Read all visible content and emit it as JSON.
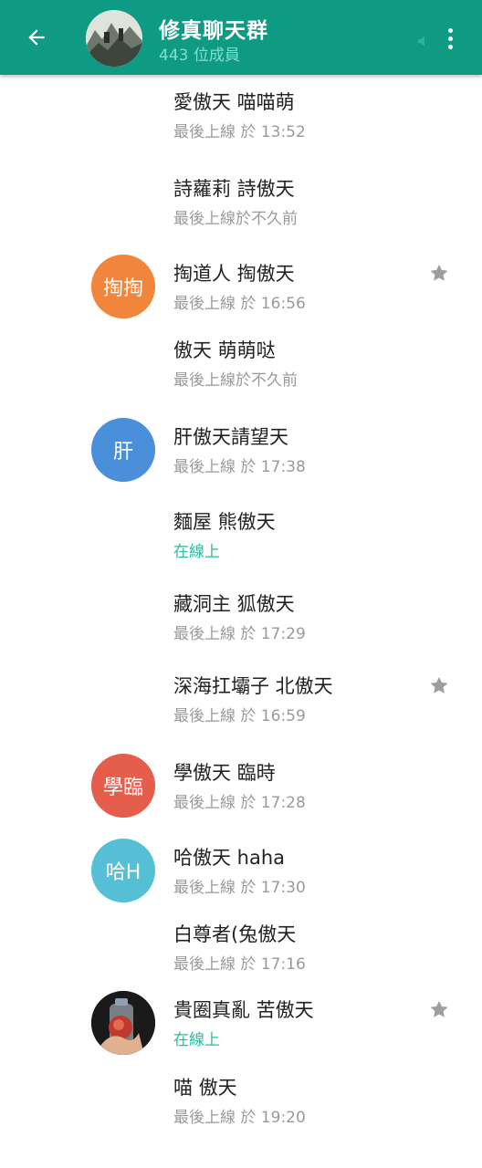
{
  "header": {
    "title": "修真聊天群",
    "subtitle": "443 位成員",
    "back_icon": "arrow-left-icon",
    "more_icon": "more-vertical-icon",
    "color": "#0e9a83"
  },
  "members": [
    {
      "name": "愛傲天 喵喵萌",
      "status": "最後上線 於 13:52",
      "online": false,
      "starred": false,
      "avatar": null
    },
    {
      "name": "詩蘿莉 詩傲天",
      "status": "最後上線於不久前",
      "online": false,
      "starred": false,
      "avatar": null
    },
    {
      "name": "掏道人 掏傲天",
      "status": "最後上線 於 16:56",
      "online": false,
      "starred": true,
      "avatar": {
        "text": "掏掏",
        "color": "#f0853b"
      }
    },
    {
      "name": "傲天 萌萌哒",
      "status": "最後上線於不久前",
      "online": false,
      "starred": false,
      "avatar": null
    },
    {
      "name": "肝傲天請望天",
      "status": "最後上線 於 17:38",
      "online": false,
      "starred": false,
      "avatar": {
        "text": "肝",
        "color": "#4a8fd9"
      }
    },
    {
      "name": "麵屋 熊傲天",
      "status": "在線上",
      "online": true,
      "starred": false,
      "avatar": null
    },
    {
      "name": "藏洞主 狐傲天",
      "status": "最後上線 於 17:29",
      "online": false,
      "starred": false,
      "avatar": null
    },
    {
      "name": "深海扛壩子 北傲天",
      "status": "最後上線 於 16:59",
      "online": false,
      "starred": true,
      "avatar": null
    },
    {
      "name": "學傲天 臨時",
      "status": "最後上線 於 17:28",
      "online": false,
      "starred": false,
      "avatar": {
        "text": "學臨",
        "color": "#e55d4b"
      }
    },
    {
      "name": "哈傲天 haha",
      "status": "最後上線 於 17:30",
      "online": false,
      "starred": false,
      "avatar": {
        "text": "哈H",
        "color": "#55bfd6"
      }
    },
    {
      "name": "白尊者(兔傲天",
      "status": "最後上線 於 17:16",
      "online": false,
      "starred": false,
      "avatar": null
    },
    {
      "name": "貴圈真亂 苦傲天",
      "status": "在線上",
      "online": true,
      "starred": true,
      "avatar": {
        "text": "",
        "color": "#1a1a1a",
        "photo": true
      }
    },
    {
      "name": "喵 傲天",
      "status": "最後上線 於 19:20",
      "online": false,
      "starred": false,
      "avatar": null
    }
  ]
}
